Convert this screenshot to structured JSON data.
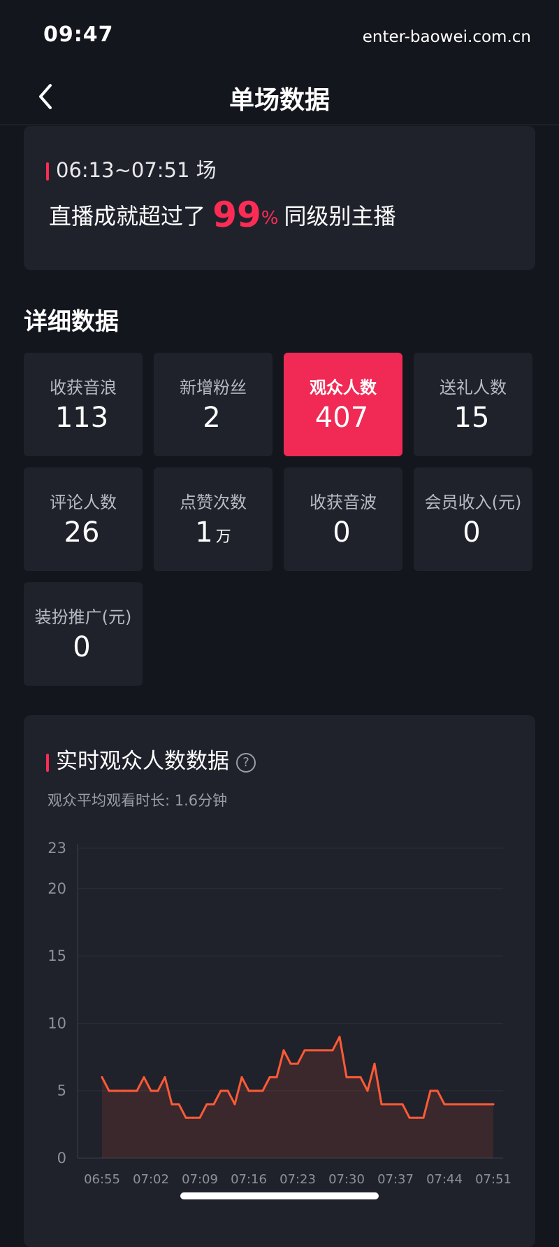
{
  "status_bar": {
    "time": "09:47"
  },
  "watermark": "enter-baowei.com.cn",
  "nav": {
    "title": "单场数据"
  },
  "session": {
    "time_range": "06:13~07:51 场",
    "achievement_prefix": "直播成就超过了",
    "percentile": "99",
    "percent_sign": "%",
    "achievement_suffix": "同级别主播"
  },
  "details": {
    "title": "详细数据",
    "tiles": [
      {
        "label": "收获音浪",
        "value": "113",
        "unit": ""
      },
      {
        "label": "新增粉丝",
        "value": "2",
        "unit": ""
      },
      {
        "label": "观众人数",
        "value": "407",
        "unit": ""
      },
      {
        "label": "送礼人数",
        "value": "15",
        "unit": ""
      },
      {
        "label": "评论人数",
        "value": "26",
        "unit": ""
      },
      {
        "label": "点赞次数",
        "value": "1",
        "unit": "万"
      },
      {
        "label": "收获音波",
        "value": "0",
        "unit": ""
      },
      {
        "label": "会员收入(元)",
        "value": "0",
        "unit": ""
      },
      {
        "label": "装扮推广(元)",
        "value": "0",
        "unit": ""
      }
    ],
    "active_index": 2
  },
  "realtime": {
    "title": "实时观众人数数据",
    "help_icon": "question-circle-icon",
    "avg_watch": "观众平均观看时长: 1.6分钟"
  },
  "colors": {
    "accent": "#fe2c55",
    "line": "#ff5a36",
    "card": "#1f222b",
    "background": "#14161d"
  },
  "chart_data": {
    "type": "line",
    "ylim": [
      0,
      23
    ],
    "yticks": [
      "0",
      "5",
      "10",
      "15",
      "20",
      "23"
    ],
    "xticks": [
      "06:55",
      "07:02",
      "07:09",
      "07:16",
      "07:23",
      "07:30",
      "07:37",
      "07:44",
      "07:51"
    ],
    "series": [
      {
        "x": [
          "06:55",
          "06:56",
          "06:57",
          "06:58",
          "06:59",
          "07:00",
          "07:01",
          "07:02",
          "07:03",
          "07:04",
          "07:05",
          "07:06",
          "07:07",
          "07:08",
          "07:09",
          "07:10",
          "07:11",
          "07:12",
          "07:13",
          "07:14",
          "07:15",
          "07:16",
          "07:17",
          "07:18",
          "07:19",
          "07:20",
          "07:21",
          "07:22",
          "07:23",
          "07:24",
          "07:25",
          "07:26",
          "07:27",
          "07:28",
          "07:29",
          "07:30",
          "07:31",
          "07:32",
          "07:33",
          "07:34",
          "07:35",
          "07:36",
          "07:37",
          "07:38",
          "07:39",
          "07:40",
          "07:41",
          "07:42",
          "07:43",
          "07:44",
          "07:45",
          "07:46",
          "07:47",
          "07:48",
          "07:49",
          "07:50",
          "07:51"
        ],
        "values": [
          6,
          5,
          5,
          5,
          5,
          5,
          6,
          5,
          5,
          6,
          4,
          4,
          3,
          3,
          3,
          4,
          4,
          5,
          5,
          4,
          6,
          5,
          5,
          5,
          6,
          6,
          8,
          7,
          7,
          8,
          8,
          8,
          8,
          8,
          9,
          6,
          6,
          6,
          5,
          7,
          4,
          4,
          4,
          4,
          3,
          3,
          3,
          5,
          5,
          4,
          4,
          4,
          4,
          4,
          4,
          4,
          4
        ]
      }
    ]
  }
}
